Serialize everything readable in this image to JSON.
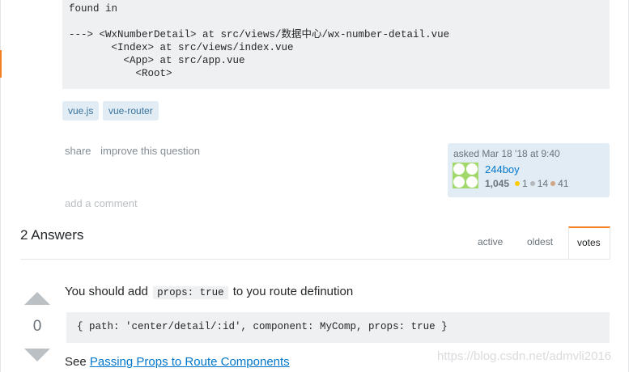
{
  "question": {
    "code_lines": [
      "found in",
      "",
      "---> <WxNumberDetail> at src/views/数据中心/wx-number-detail.vue",
      "       <Index> at src/views/index.vue",
      "         <App> at src/app.vue",
      "           <Root>"
    ],
    "tags": [
      "vue.js",
      "vue-router"
    ],
    "post_menu": {
      "share": "share",
      "improve": "improve this question"
    },
    "owner": {
      "asked": "asked Mar 18 '18 at 9:40",
      "name": "244boy",
      "reputation": "1,045",
      "gold": "1",
      "silver": "14",
      "bronze": "41"
    },
    "add_comment": "add a comment"
  },
  "answers_header": {
    "title": "2 Answers",
    "tabs": [
      "active",
      "oldest",
      "votes"
    ],
    "active_tab": "votes"
  },
  "answer": {
    "votes": "0",
    "text_before": "You should add",
    "inline_code": "props: true",
    "text_after": "to you route definution",
    "code": "{ path: 'center/detail/:id', component: MyComp, props: true }",
    "see_prefix": "See",
    "link_text": "Passing Props to Route Components"
  },
  "watermark": "https://blog.csdn.net/admvli2016",
  "colors": {
    "link": "#0077cc",
    "tag_bg": "#e1ecf4",
    "accent": "#f48024",
    "code_bg": "#eff0f1"
  }
}
